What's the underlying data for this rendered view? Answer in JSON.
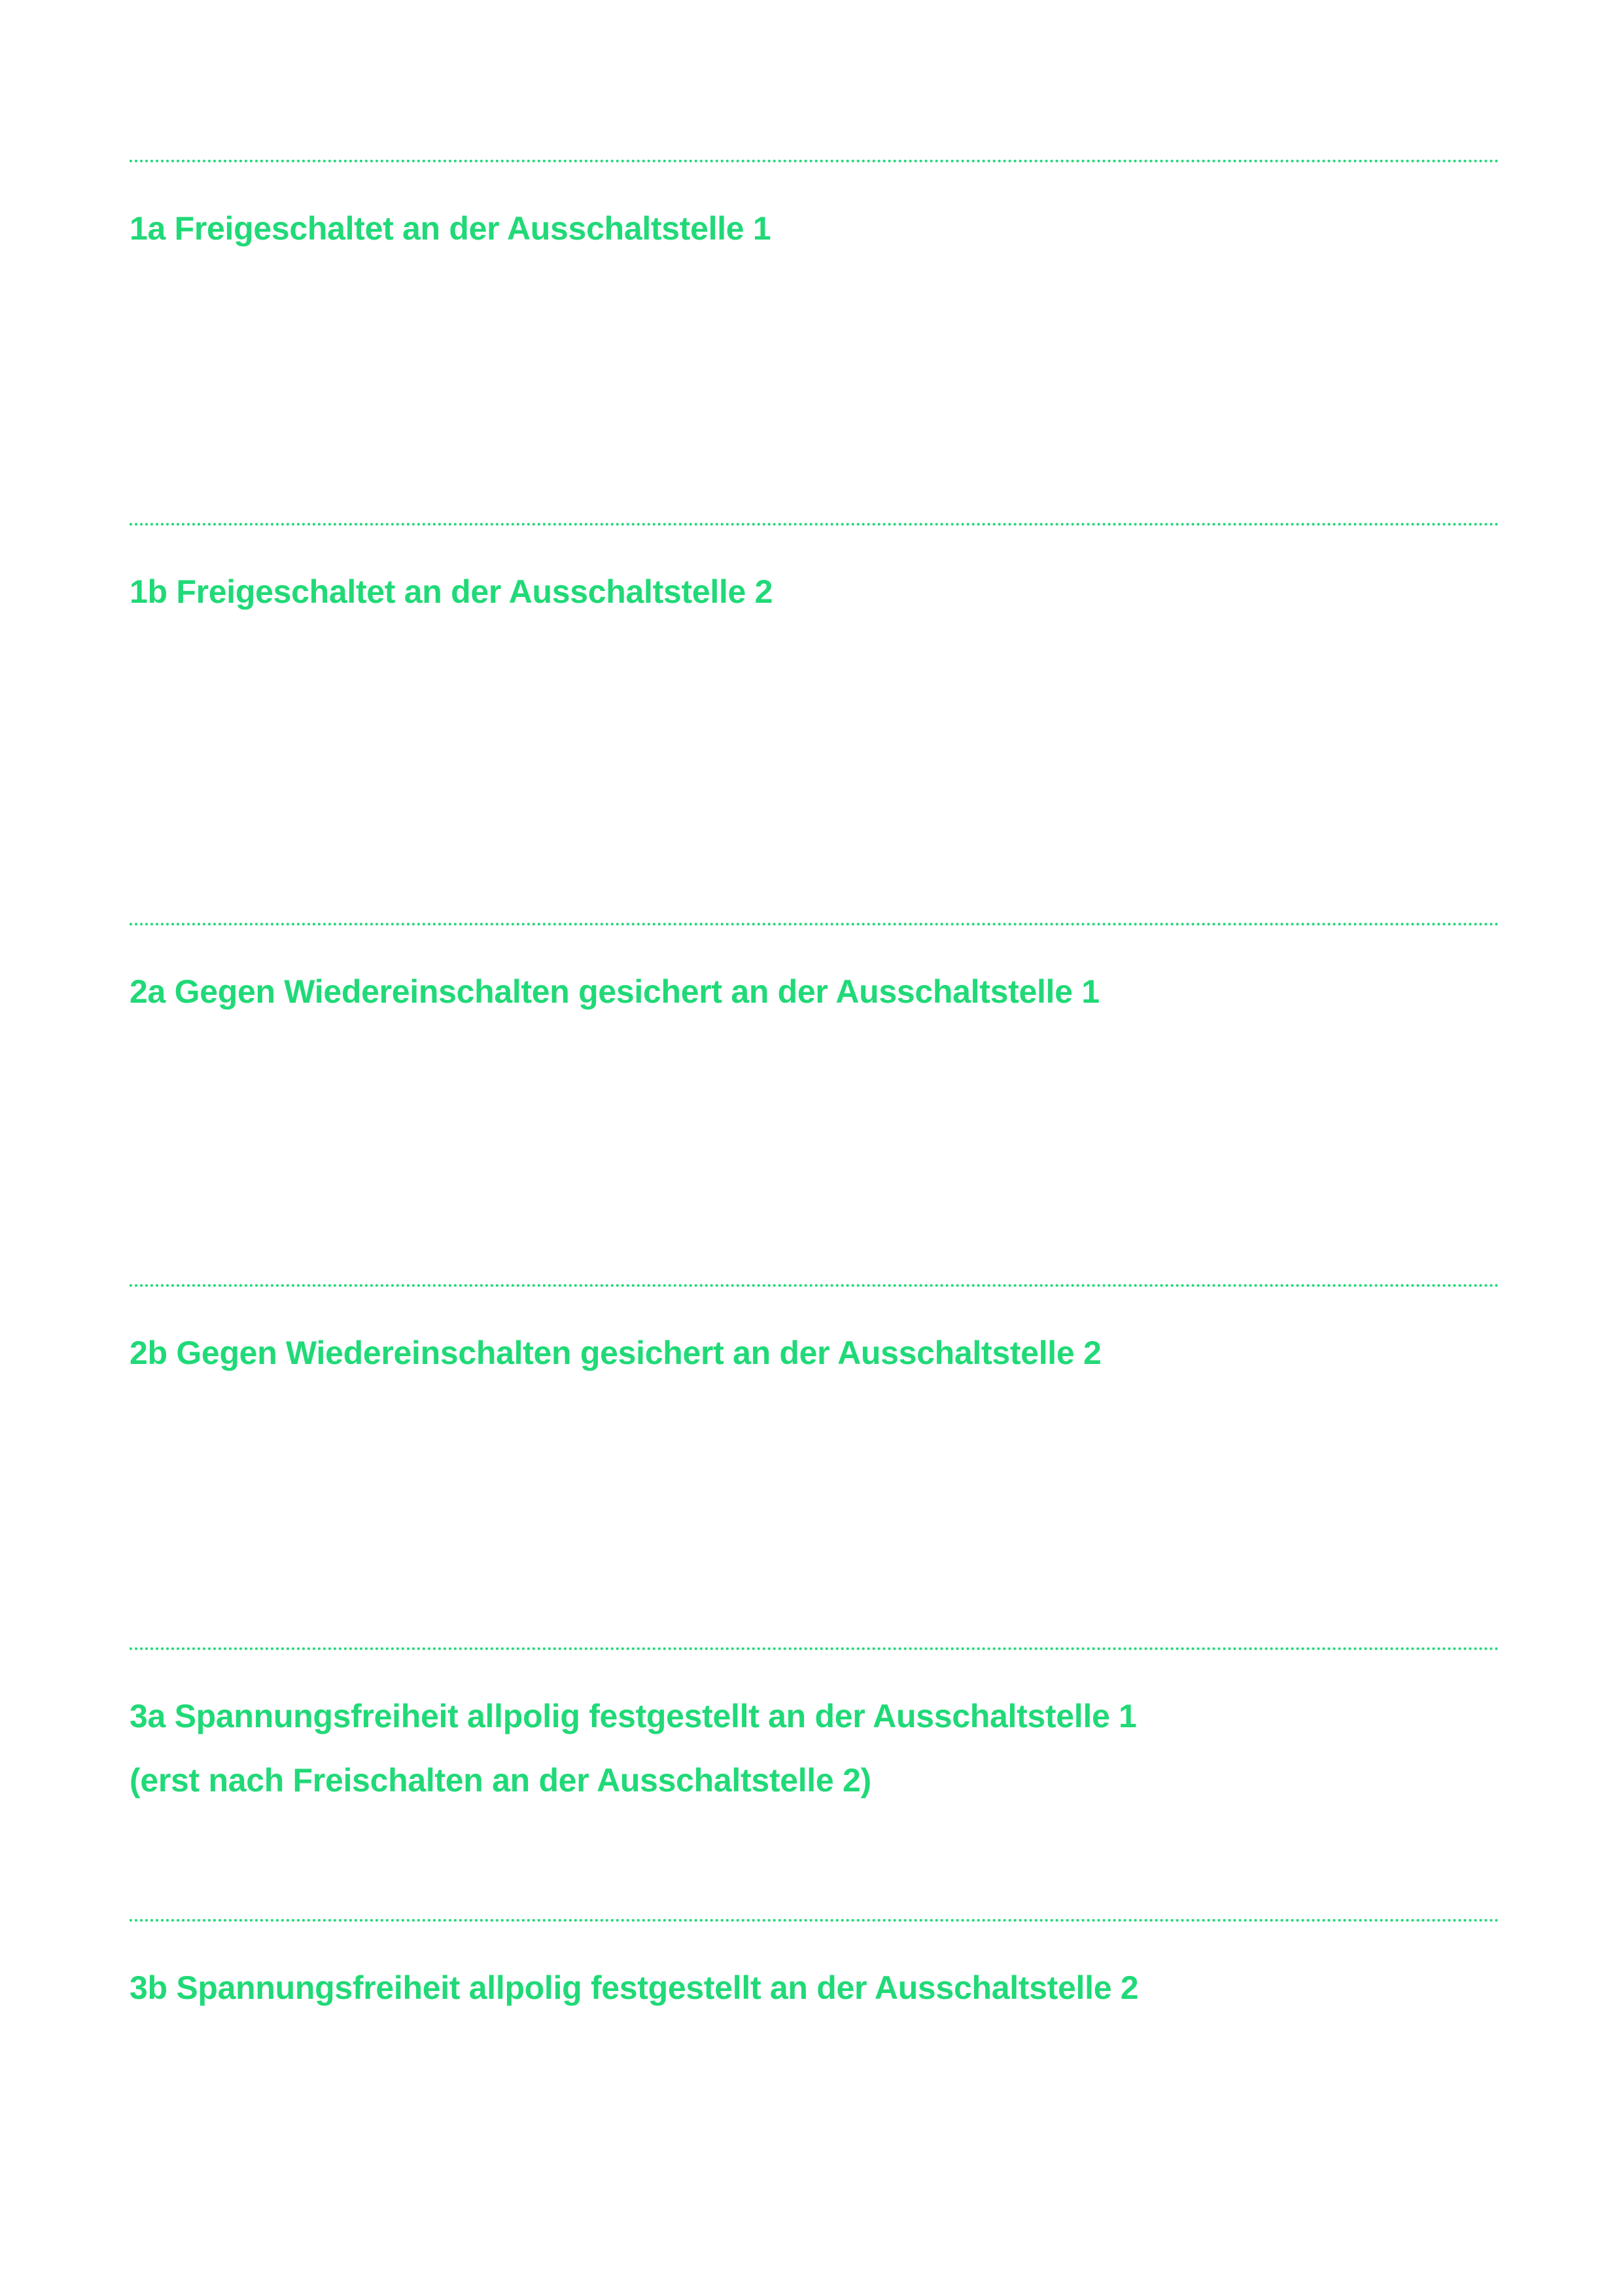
{
  "colors": {
    "accent": "#20d977"
  },
  "sections": [
    {
      "lines": [
        "1a Freigeschaltet an der Ausschaltstelle 1"
      ]
    },
    {
      "lines": [
        "1b Freigeschaltet an der Ausschaltstelle 2"
      ]
    },
    {
      "lines": [
        "2a Gegen Wiedereinschalten gesichert an der Ausschaltstelle 1"
      ]
    },
    {
      "lines": [
        "2b Gegen Wiedereinschalten gesichert an der Ausschaltstelle 2"
      ]
    },
    {
      "lines": [
        "3a Spannungsfreiheit allpolig festgestellt an der Ausschaltstelle 1",
        "(erst nach Freischalten an der Ausschaltstelle 2)"
      ]
    },
    {
      "lines": [
        "3b Spannungsfreiheit allpolig festgestellt an der Ausschaltstelle 2"
      ]
    }
  ]
}
